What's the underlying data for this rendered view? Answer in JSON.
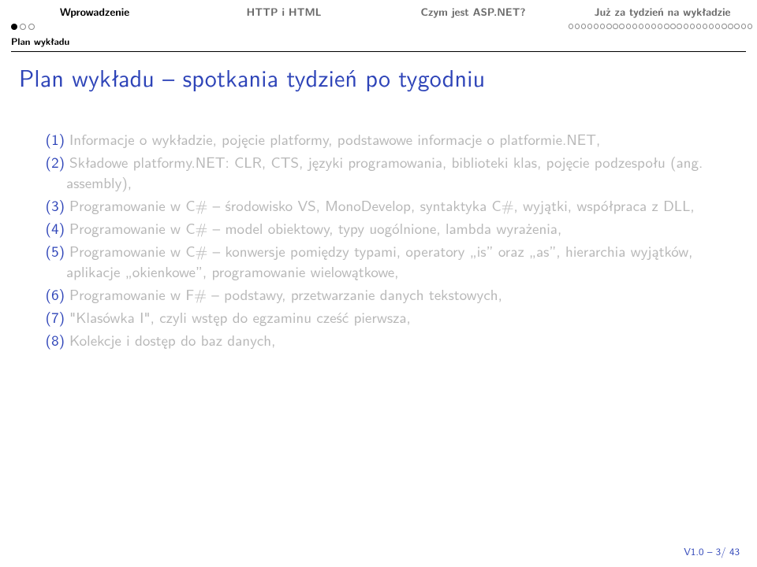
{
  "topnav": {
    "segments": [
      {
        "label": "Wprowadzenie",
        "active": true
      },
      {
        "label": "HTTP i HTML",
        "active": false
      },
      {
        "label": "Czym jest ASP.NET?",
        "active": false
      },
      {
        "label": "Już za tydzień na wykładzie",
        "active": false
      }
    ]
  },
  "progress": {
    "seg0": {
      "total": 3,
      "filled": 1
    },
    "seg1": {
      "total": 0,
      "filled": 0
    },
    "seg2": {
      "total": 0,
      "filled": 0
    },
    "seg3": {
      "total": 29,
      "filled": 0
    }
  },
  "subsection": "Plan wykładu",
  "title": "Plan wykładu – spotkania tydzień po tygodniu",
  "items": [
    "Informacje o wykładzie, pojęcie platformy, podstawowe informacje o platformie.NET,",
    "Składowe platformy.NET: CLR, CTS, języki programowania, biblioteki klas, pojęcie podzespołu (ang. assembly),",
    "Programowanie w C# – środowisko VS, MonoDevelop, syntaktyka C#, wyjątki, współpraca z DLL,",
    "Programowanie w C# – model obiektowy, typy uogólnione, lambda wyrażenia,",
    "Programowanie w C# – konwersje pomiędzy typami, operatory „is” oraz „as”, hierarchia wyjątków, aplikacje „okienkowe”, programowanie wielowątkowe,",
    "Programowanie w F# – podstawy, przetwarzanie danych tekstowych,",
    "\"Klasówka I\", czyli wstęp do egzaminu cześć pierwsza,",
    "Kolekcje i dostęp do baz danych,"
  ],
  "footer": "V1.0 – 3/ 43"
}
